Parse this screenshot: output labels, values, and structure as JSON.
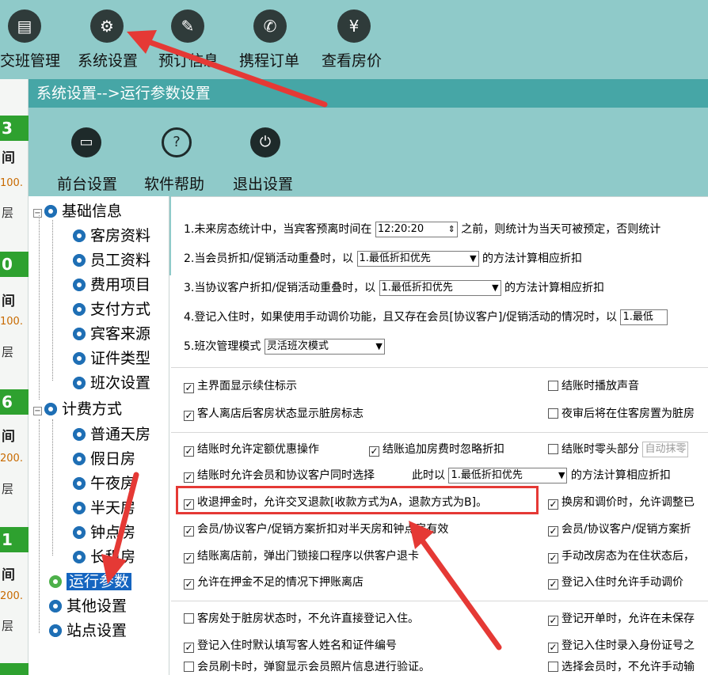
{
  "topbar": {
    "items": [
      {
        "label": "交班管理",
        "icon": "clipboard-icon"
      },
      {
        "label": "系统设置",
        "icon": "gears-icon"
      },
      {
        "label": "预订信息",
        "icon": "booking-icon"
      },
      {
        "label": "携程订单",
        "icon": "ctrip-icon"
      },
      {
        "label": "查看房价",
        "icon": "yuan-icon"
      }
    ]
  },
  "rooms": [
    {
      "num": "3",
      "title": "间",
      "price": "100.",
      "floor": "层"
    },
    {
      "num": "0",
      "title": "间",
      "price": "100.",
      "floor": "层"
    },
    {
      "num": "6",
      "title": "间",
      "price": "200.",
      "floor": "层"
    },
    {
      "num": "1",
      "title": "间",
      "price": "200.",
      "floor": "层"
    }
  ],
  "window": {
    "title": "系统设置-->运行参数设置",
    "toolbar": [
      {
        "label": "前台设置",
        "icon": "monitor-icon"
      },
      {
        "label": "软件帮助",
        "icon": "question-icon"
      },
      {
        "label": "退出设置",
        "icon": "power-icon"
      }
    ]
  },
  "tree": {
    "groups": [
      {
        "label": "基础信息",
        "children": [
          "客房资料",
          "员工资料",
          "费用项目",
          "支付方式",
          "宾客来源",
          "证件类型",
          "班次设置"
        ]
      },
      {
        "label": "计费方式",
        "children": [
          "普通天房",
          "假日房",
          "午夜房",
          "半天房",
          "钟点房",
          "长租房"
        ]
      }
    ],
    "selected": "运行参数",
    "others": [
      "其他设置",
      "站点设置"
    ]
  },
  "settings": {
    "r1_prefix": "1.未来房态统计中，当宾客预离时间在",
    "r1_time": "12:20:20",
    "r1_suffix": "之前，则统计为当天可被预定，否则统计",
    "r2_prefix": "2.当会员折扣/促销活动重叠时，以",
    "r2_combo": "1.最低折扣优先",
    "r2_suffix": "的方法计算相应折扣",
    "r3_prefix": "3.当协议客户折扣/促销活动重叠时，以",
    "r3_combo": "1.最低折扣优先",
    "r3_suffix": "的方法计算相应折扣",
    "r4_prefix": "4.登记入住时，如果使用手动调价功能，且又存在会员[协议客户]/促销活动的情况时，以",
    "r4_combo": "1.最低",
    "r5_prefix": "5.班次管理模式",
    "r5_combo": "灵活班次模式"
  },
  "checks": {
    "c1": "主界面显示续住标示",
    "c1r": "结账时播放声音",
    "c2": "客人离店后客房状态显示脏房标志",
    "c2r": "夜审后将在住客房置为脏房",
    "c3": "结账时允许定额优惠操作",
    "c3m": "结账追加房费时忽略折扣",
    "c3r": "结账时零头部分",
    "c3r_combo": "自动抹零",
    "c4": "结账时允许会员和协议客户同时选择",
    "c4_mid": "此时以",
    "c4_combo": "1.最低折扣优先",
    "c4_suffix": "的方法计算相应折扣",
    "c5": "收退押金时，允许交叉退款[收款方式为A，退款方式为B]。",
    "c5r": "换房和调价时，允许调整已",
    "c6": "会员/协议客户/促销方案折扣对半天房和钟点房有效",
    "c6r": "会员/协议客户/促销方案折",
    "c7": "结账离店前，弹出门锁接口程序以供客户退卡",
    "c7r": "手动改房态为在住状态后，",
    "c8": "允许在押金不足的情况下押账离店",
    "c8r": "登记入住时允许手动调价",
    "c9": "客房处于脏房状态时，不允许直接登记入住。",
    "c9r": "登记开单时，允许在未保存",
    "c10": "登记入住时默认填写客人姓名和证件编号",
    "c10r": "登记入住时录入身份证号之",
    "c11": "会员刷卡时，弹窗显示会员照片信息进行验证。",
    "c11r": "选择会员时，不允许手动输"
  },
  "colors": {
    "toolbar": "#8fcac9",
    "title_bar": "#46a6a6",
    "room_green": "#2ea12f",
    "highlight": "#e53935",
    "tree_selected": "#1565c0"
  }
}
